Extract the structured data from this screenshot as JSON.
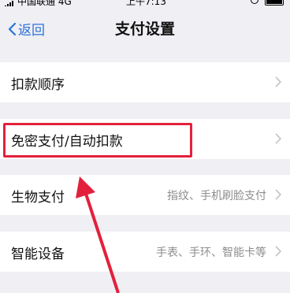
{
  "status": {
    "carrier": "中国联通 4G",
    "time": "上午7:13"
  },
  "nav": {
    "back_label": "返回",
    "title": "支付设置"
  },
  "rows": [
    {
      "label": "扣款顺序",
      "detail": ""
    },
    {
      "label": "免密支付/自动扣款",
      "detail": ""
    },
    {
      "label": "生物支付",
      "detail": "指纹、手机刷脸支付"
    },
    {
      "label": "智能设备",
      "detail": "手表、手环、智能卡等"
    }
  ],
  "colors": {
    "accent": "#2c73d8",
    "highlight": "#e3203b",
    "background": "#efeff4"
  }
}
